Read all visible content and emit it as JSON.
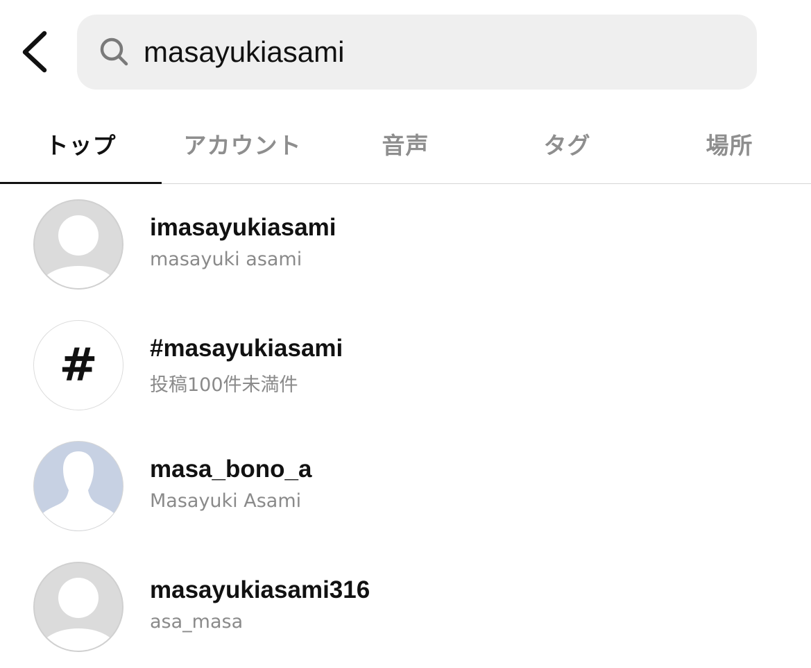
{
  "search": {
    "query": "masayukiasami"
  },
  "tabs": [
    {
      "label": "トップ",
      "active": true
    },
    {
      "label": "アカウント",
      "active": false
    },
    {
      "label": "音声",
      "active": false
    },
    {
      "label": "タグ",
      "active": false
    },
    {
      "label": "場所",
      "active": false
    }
  ],
  "results": [
    {
      "title": "imasayukiasami",
      "subtitle": "masayuki asami",
      "avatar": "default-avatar-icon"
    },
    {
      "title": "#masayukiasami",
      "subtitle": "投稿100件未満件",
      "avatar": "hashtag-icon",
      "hash_symbol": "#"
    },
    {
      "title": "masa_bono_a",
      "subtitle": "Masayuki Asami",
      "avatar": "silhouette-avatar-icon"
    },
    {
      "title": "masayukiasami316",
      "subtitle": "asa_masa",
      "avatar": "default-avatar-icon"
    }
  ],
  "colors": {
    "search_bg": "#efefef",
    "avatar_gray": "#dbdbdb",
    "avatar_blue": "#c7d1e3",
    "muted_text": "#8a8a8a",
    "tab_inactive": "#8e8e8e"
  }
}
